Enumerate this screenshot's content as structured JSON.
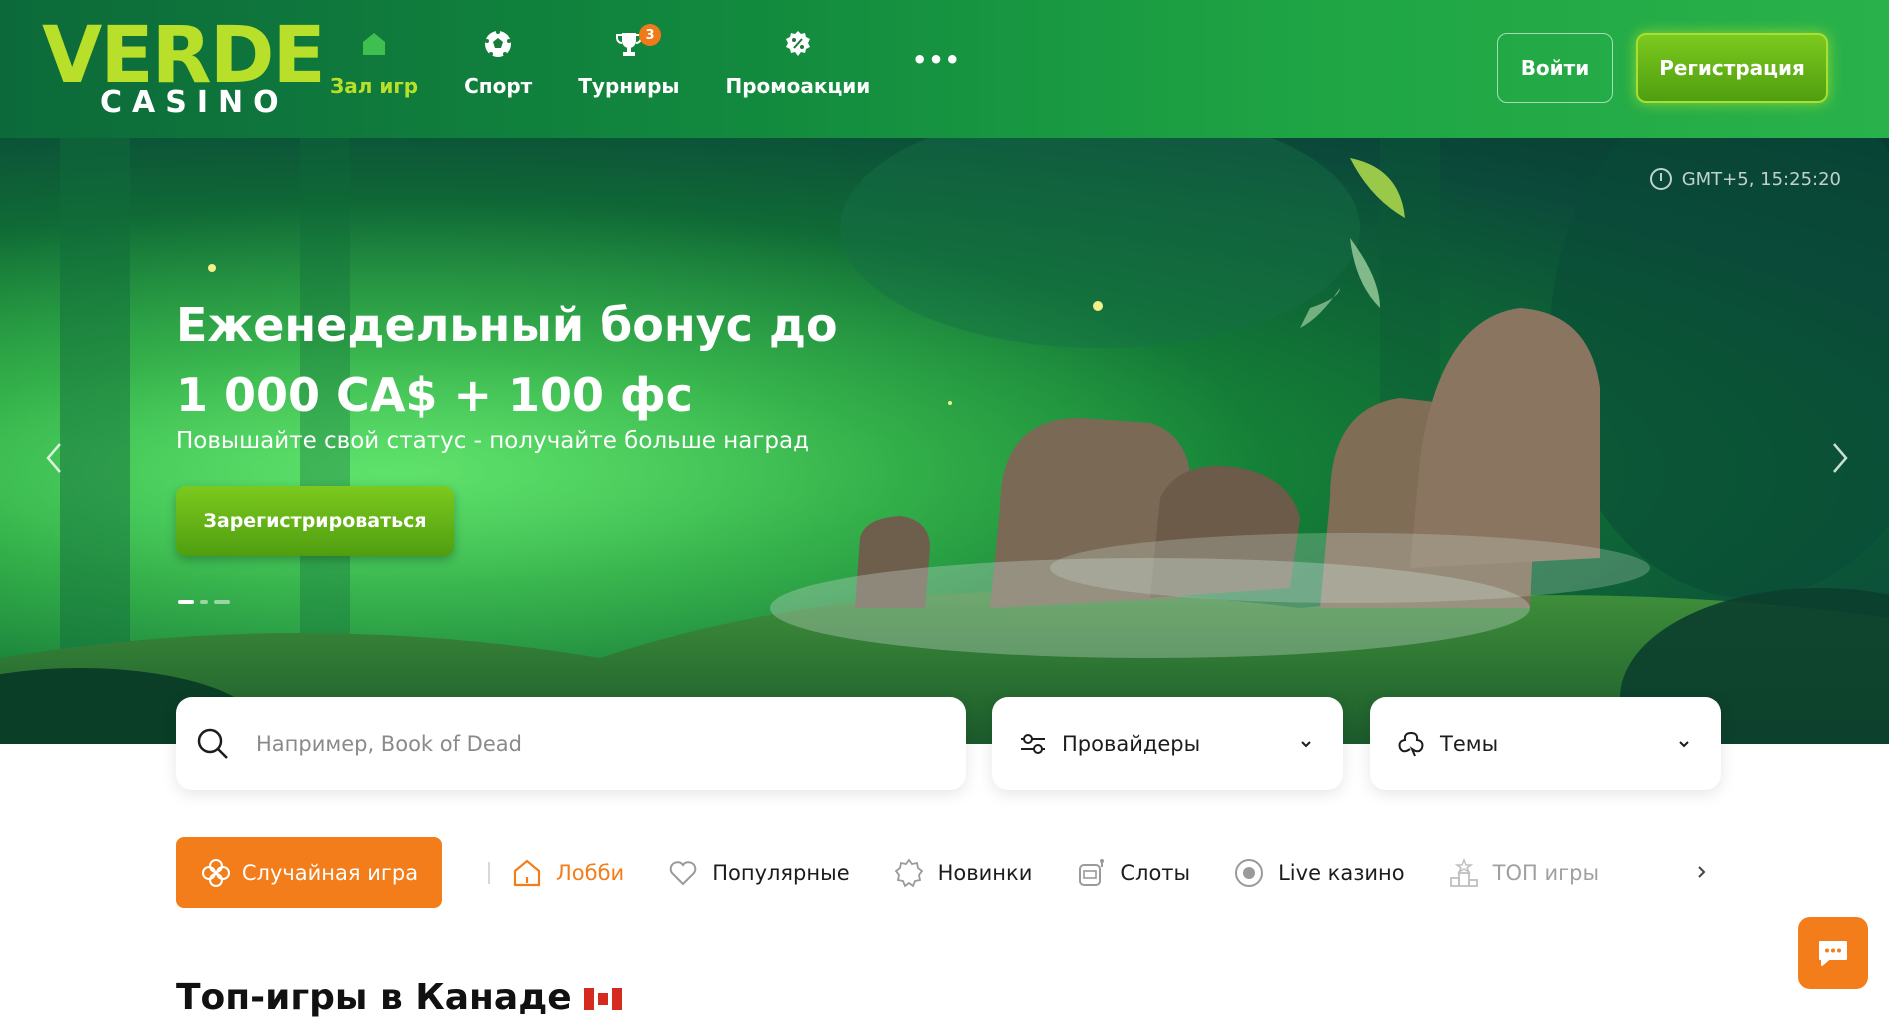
{
  "header": {
    "logo_main": "VERDE",
    "logo_sub": "CASINO",
    "nav": [
      {
        "label": "Зал игр",
        "icon": "home-icon",
        "active": true
      },
      {
        "label": "Спорт",
        "icon": "soccer-ball-icon"
      },
      {
        "label": "Турниры",
        "icon": "trophy-icon",
        "badge": "3"
      },
      {
        "label": "Промоакции",
        "icon": "discount-badge-icon"
      }
    ],
    "more_label": "•••",
    "login_label": "Войти",
    "register_label": "Регистрация"
  },
  "hero": {
    "time": "GMT+5,  15:25:20",
    "title_line1": "Еженедельный бонус до",
    "title_line2": "1 000 CA$ + 100 фс",
    "subtitle": "Повышайте свой статус - получайте больше наград",
    "cta_label": "Зарегистрироваться",
    "slides_total": 3,
    "active_slide": 1
  },
  "search": {
    "placeholder": "Например, Book of Dead",
    "value": ""
  },
  "filters": {
    "providers_label": "Провайдеры",
    "themes_label": "Темы"
  },
  "categories": {
    "random_label": "Случайная игра",
    "tabs": [
      {
        "label": "Лобби",
        "icon": "home-icon",
        "active": true
      },
      {
        "label": "Популярные",
        "icon": "heart-icon"
      },
      {
        "label": "Новинки",
        "icon": "new-badge-icon"
      },
      {
        "label": "Слоты",
        "icon": "slot-machine-icon"
      },
      {
        "label": "Live казино",
        "icon": "live-dot-icon"
      },
      {
        "label": "ТОП игры",
        "icon": "podium-icon"
      }
    ]
  },
  "section": {
    "title": "Топ-игры в Канаде"
  },
  "colors": {
    "brand_green": "#1c9a3a",
    "accent_lime": "#b8e02a",
    "accent_orange": "#f27d1a"
  }
}
